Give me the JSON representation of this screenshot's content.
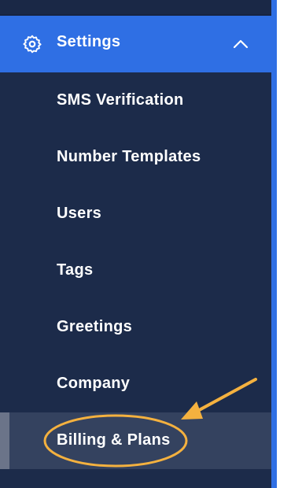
{
  "sidebar": {
    "settings": {
      "label": "Settings",
      "icon": "gear-icon",
      "chevron": "chevron-up-icon"
    },
    "items": [
      {
        "label": "SMS Verification"
      },
      {
        "label": "Number Templates"
      },
      {
        "label": "Users"
      },
      {
        "label": "Tags"
      },
      {
        "label": "Greetings"
      },
      {
        "label": "Company"
      },
      {
        "label": "Billing & Plans",
        "active": true
      }
    ]
  },
  "annotation": {
    "shapes": [
      "ellipse",
      "arrow"
    ],
    "color": "#f4b13f"
  },
  "colors": {
    "sidebar_bg": "#1c2b4a",
    "accent": "#2f6fe4",
    "active_bg": "#34425f",
    "text": "#ffffff"
  }
}
